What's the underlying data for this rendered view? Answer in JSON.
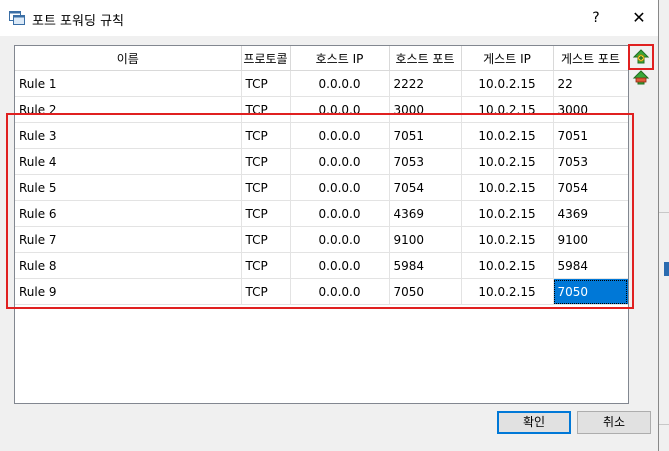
{
  "dialog": {
    "title": "포트 포워딩 규칙",
    "help": "?",
    "close": "✕"
  },
  "table": {
    "columns": [
      "이름",
      "프로토콜",
      "호스트 IP",
      "호스트 포트",
      "게스트 IP",
      "게스트 포트"
    ],
    "rows": [
      [
        "Rule 1",
        "TCP",
        "0.0.0.0",
        "2222",
        "10.0.2.15",
        "22"
      ],
      [
        "Rule 2",
        "TCP",
        "0.0.0.0",
        "3000",
        "10.0.2.15",
        "3000"
      ],
      [
        "Rule 3",
        "TCP",
        "0.0.0.0",
        "7051",
        "10.0.2.15",
        "7051"
      ],
      [
        "Rule 4",
        "TCP",
        "0.0.0.0",
        "7053",
        "10.0.2.15",
        "7053"
      ],
      [
        "Rule 5",
        "TCP",
        "0.0.0.0",
        "7054",
        "10.0.2.15",
        "7054"
      ],
      [
        "Rule 6",
        "TCP",
        "0.0.0.0",
        "4369",
        "10.0.2.15",
        "4369"
      ],
      [
        "Rule 7",
        "TCP",
        "0.0.0.0",
        "9100",
        "10.0.2.15",
        "9100"
      ],
      [
        "Rule 8",
        "TCP",
        "0.0.0.0",
        "5984",
        "10.0.2.15",
        "5984"
      ],
      [
        "Rule 9",
        "TCP",
        "0.0.0.0",
        "7050",
        "10.0.2.15",
        "7050"
      ]
    ]
  },
  "side_buttons": {
    "add_icon": "add-rule-icon",
    "remove_icon": "remove-rule-icon"
  },
  "buttons": {
    "ok": "확인",
    "cancel": "취소"
  },
  "colors": {
    "selection": "#0078d7",
    "highlight_box": "#e02020"
  }
}
